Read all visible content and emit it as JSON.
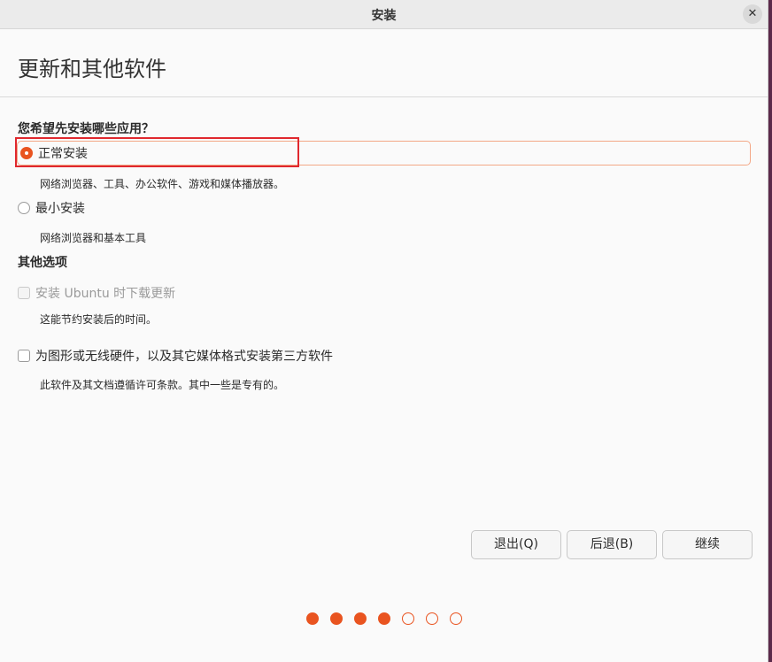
{
  "window": {
    "title": "安装",
    "close_glyph": "✕"
  },
  "page_title": "更新和其他软件",
  "install_type": {
    "heading": "您希望先安装哪些应用？",
    "options": [
      {
        "label": "正常安装",
        "description": "网络浏览器、工具、办公软件、游戏和媒体播放器。",
        "selected": true
      },
      {
        "label": "最小安装",
        "description": "网络浏览器和基本工具",
        "selected": false
      }
    ]
  },
  "other_options": {
    "heading": "其他选项",
    "items": [
      {
        "label": "安装 Ubuntu 时下载更新",
        "description": "这能节约安装后的时间。",
        "checked": false,
        "enabled": false
      },
      {
        "label": "为图形或无线硬件，以及其它媒体格式安装第三方软件",
        "description": "此软件及其文档遵循许可条款。其中一些是专有的。",
        "checked": false,
        "enabled": true
      }
    ]
  },
  "buttons": {
    "quit": "退出(Q)",
    "back": "后退(B)",
    "continue": "继续"
  },
  "progress": {
    "total_steps": 7,
    "completed_steps": 4
  },
  "colors": {
    "accent": "#e95420",
    "annotation": "#e0282e"
  }
}
